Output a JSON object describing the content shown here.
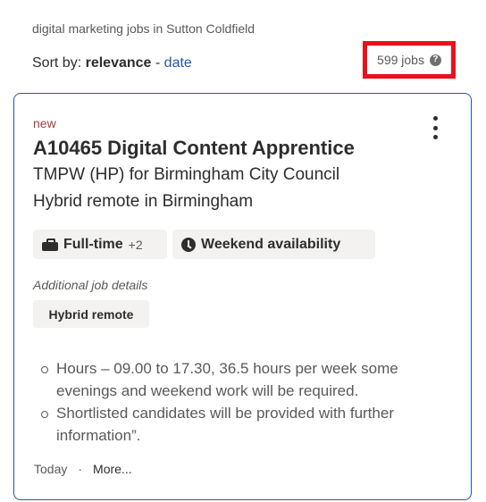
{
  "search": {
    "query_text": "digital marketing jobs in Sutton Coldfield",
    "sort_label": "Sort by:",
    "sort_active": "relevance",
    "sort_separator": "-",
    "sort_alt": "date",
    "job_count": "599 jobs",
    "help_icon": "question-circle-icon"
  },
  "job": {
    "new_tag": "new",
    "title": "A10465 Digital Content Apprentice",
    "company": "TMPW (HP) for Birmingham City Council",
    "location": "Hybrid remote in Birmingham",
    "attributes": [
      {
        "icon": "briefcase-icon",
        "label": "Full-time",
        "extra": "+2"
      },
      {
        "icon": "clock-icon",
        "label": "Weekend availability"
      }
    ],
    "additional_label": "Additional job details",
    "additional_chip": "Hybrid remote",
    "snippet": [
      "Hours – 09.00 to 17.30, 36.5 hours per week some evenings and weekend work will be required.",
      "Shortlisted candidates will be provided with further information”."
    ],
    "posted": "Today",
    "footer_separator": "·",
    "more_label": "More..."
  },
  "colors": {
    "accent": "#2557a7",
    "new_tag": "#9e3e3b",
    "highlight_box": "#e8111c",
    "chip_bg": "#f3f2f1"
  }
}
